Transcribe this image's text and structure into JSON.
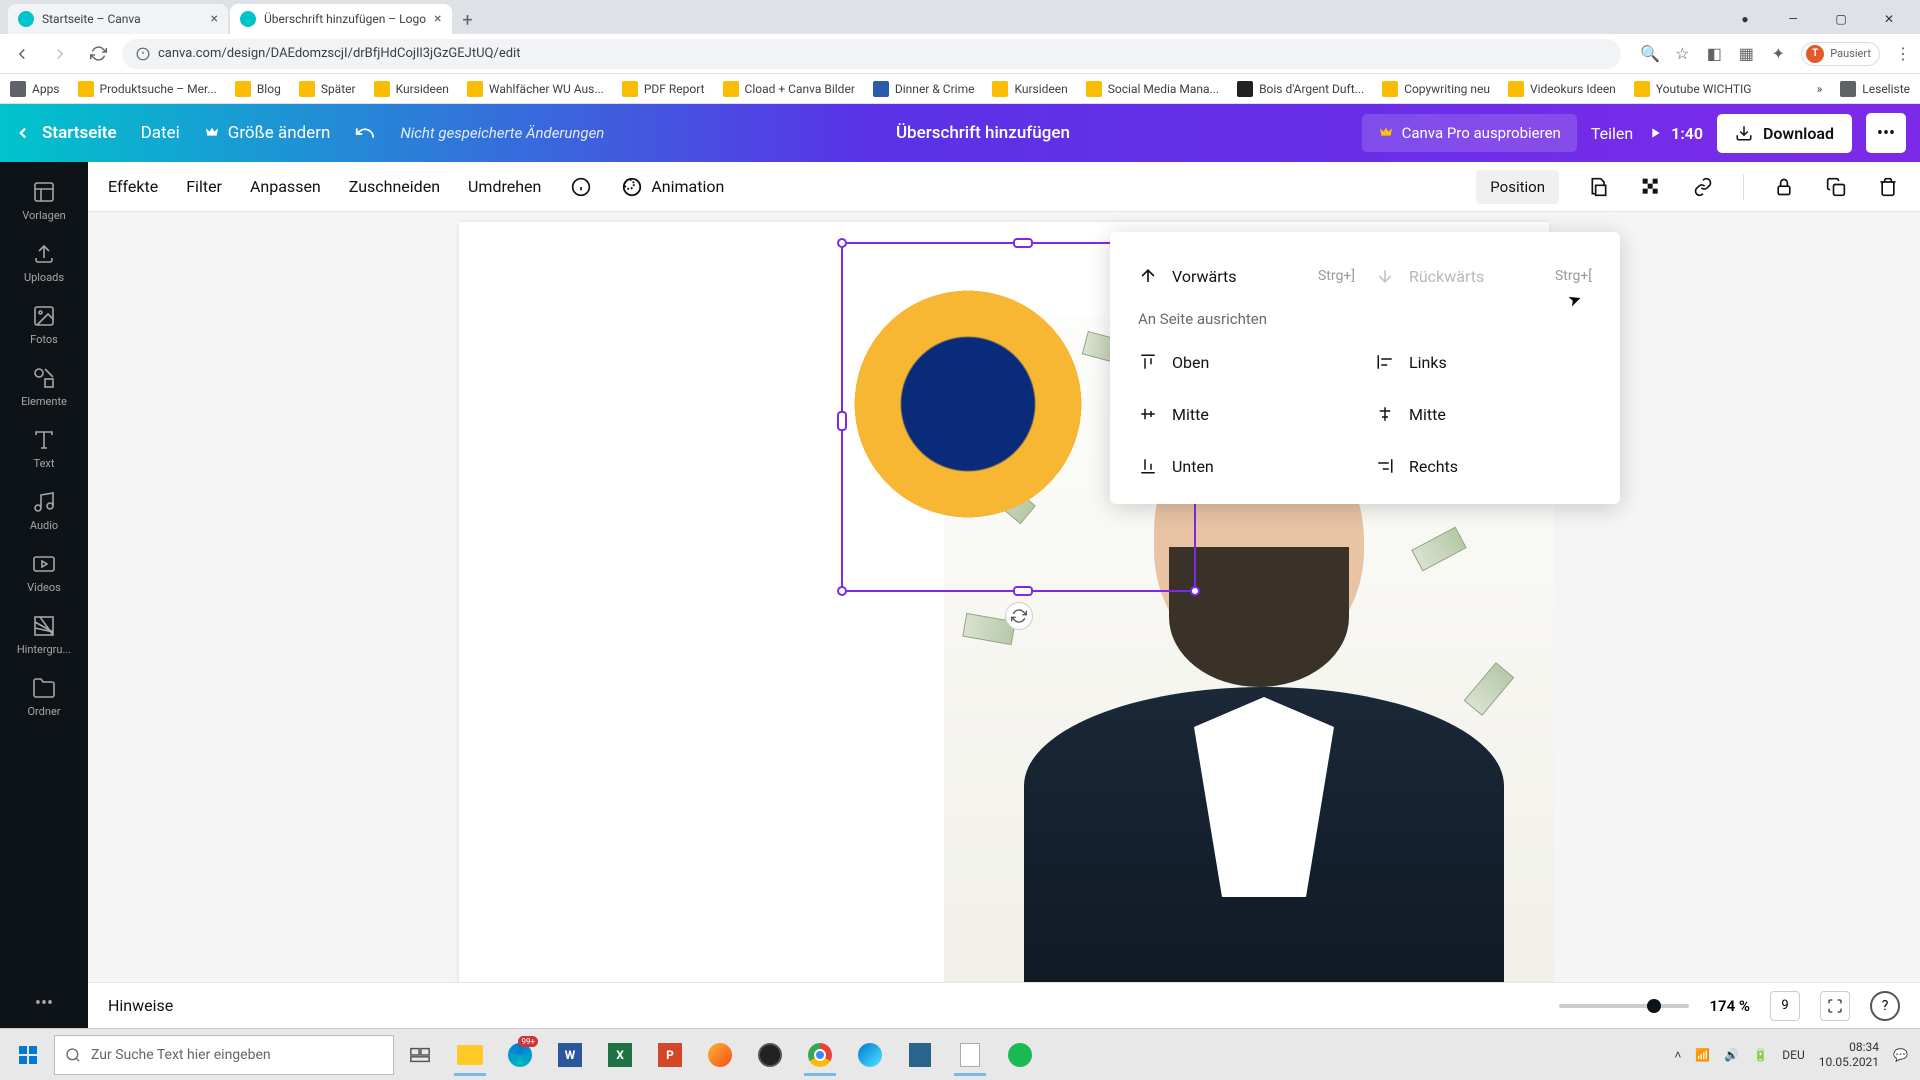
{
  "browser": {
    "tabs": [
      {
        "title": "Startseite – Canva"
      },
      {
        "title": "Überschrift hinzufügen – Logo"
      }
    ],
    "url": "canva.com/design/DAEdomzscjI/drBfjHdCojIl3jGzGEJtUQ/edit",
    "profile_label": "Pausiert",
    "bookmarks": [
      "Apps",
      "Produktsuche – Mer...",
      "Blog",
      "Später",
      "Kursideen",
      "Wahlfächer WU Aus...",
      "PDF Report",
      "Cload + Canva Bilder",
      "Dinner & Crime",
      "Kursideen",
      "Social Media Mana...",
      "Bois d'Argent Duft...",
      "Copywriting neu",
      "Videokurs Ideen",
      "Youtube WICHTIG"
    ],
    "reading_list": "Leseliste"
  },
  "canva_top": {
    "home": "Startseite",
    "file": "Datei",
    "resize": "Größe ändern",
    "status": "Nicht gespeicherte Änderungen",
    "title": "Überschrift hinzufügen",
    "pro": "Canva Pro ausprobieren",
    "share": "Teilen",
    "duration": "1:40",
    "download": "Download"
  },
  "sidebar": {
    "items": [
      "Vorlagen",
      "Uploads",
      "Fotos",
      "Elemente",
      "Text",
      "Audio",
      "Videos",
      "Hintergru...",
      "Ordner"
    ]
  },
  "toolbar": {
    "effects": "Effekte",
    "filter": "Filter",
    "adjust": "Anpassen",
    "crop": "Zuschneiden",
    "flip": "Umdrehen",
    "animation": "Animation",
    "position": "Position"
  },
  "popover": {
    "forward": "Vorwärts",
    "forward_kbd": "Strg+]",
    "backward": "Rückwärts",
    "backward_kbd": "Strg+[",
    "align_section": "An Seite ausrichten",
    "top": "Oben",
    "middle_v": "Mitte",
    "bottom": "Unten",
    "left": "Links",
    "middle_h": "Mitte",
    "right": "Rechts"
  },
  "bottom": {
    "hinweise": "Hinweise",
    "zoom_pct": "174 %",
    "pages": "9"
  },
  "taskbar": {
    "search_placeholder": "Zur Suche Text hier eingeben",
    "badge": "99+",
    "lang": "DEU",
    "time": "08:34",
    "date": "10.05.2021"
  }
}
